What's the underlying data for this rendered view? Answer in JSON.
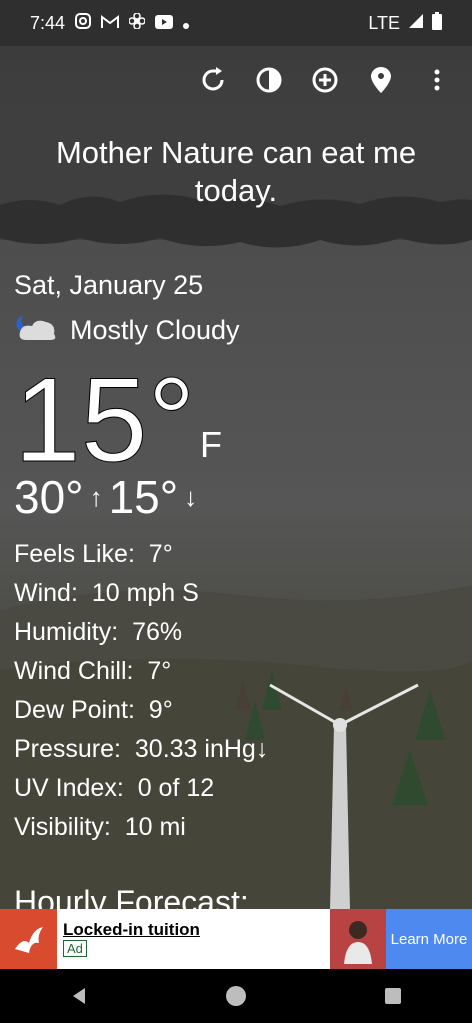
{
  "status_bar": {
    "time": "7:44",
    "network": "LTE"
  },
  "toolbar": {
    "items": [
      "refresh-icon",
      "theme-icon",
      "add-location-icon",
      "location-pin-icon",
      "overflow-menu-icon"
    ]
  },
  "headline": "Mother Nature can eat me today.",
  "weather": {
    "date": "Sat, January 25",
    "condition": "Mostly Cloudy",
    "temperature": "15°",
    "unit": "F",
    "high": "30°",
    "low": "15°",
    "details": [
      {
        "label": "Feels Like:",
        "value": "7°"
      },
      {
        "label": "Wind:",
        "value": "10 mph S"
      },
      {
        "label": "Humidity:",
        "value": "76%"
      },
      {
        "label": "Wind Chill:",
        "value": "7°"
      },
      {
        "label": "Dew Point:",
        "value": "9°"
      },
      {
        "label": "Pressure:",
        "value": "30.33 inHg↓"
      },
      {
        "label": "UV Index:",
        "value": "0 of 12"
      },
      {
        "label": "Visibility:",
        "value": "10 mi"
      }
    ],
    "hourly_title": "Hourly Forecast:"
  },
  "ad": {
    "title": "Locked-in tuition",
    "badge": "Ad",
    "cta": "Learn More"
  }
}
